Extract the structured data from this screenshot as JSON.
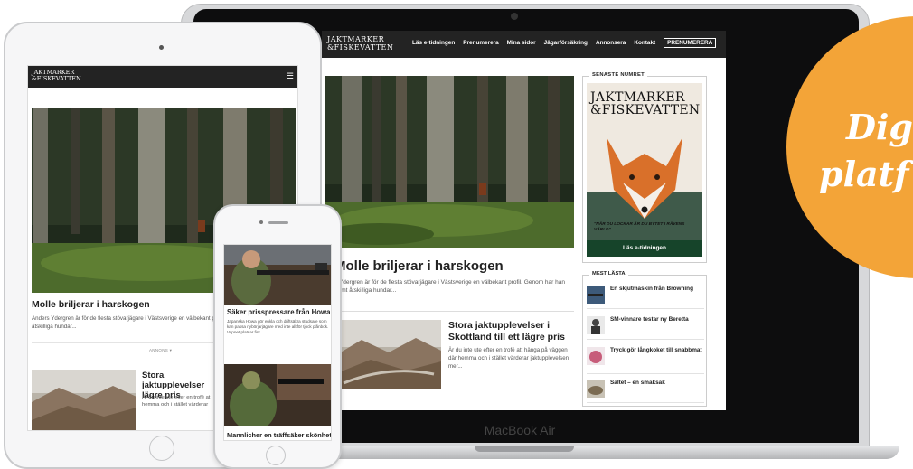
{
  "desktop": {
    "brand": "MacBook Air",
    "logo_line1": "JAKTMARKER",
    "logo_line2": "&FISKEVATTEN",
    "nav": [
      "Läs e-tidningen",
      "Prenumerera",
      "Mina sidor",
      "Jägarförsäkring",
      "Annonsera",
      "Kontakt"
    ],
    "nav_cta": "PRENUMERERA",
    "hero_title": "Molle briljerar i harskogen",
    "hero_excerpt": "s Ydergren är för de flesta stövarjägare i Västsverige en välbekant profil. Genom har han dömt åtskilliga hundar...",
    "card_title": "Stora jaktupplevelser i Skottland till ett lägre pris",
    "card_excerpt": "Är du inte ute efter en trofé att hänga på väggen där hemma och i stället värderar jaktupplevelsen mer...",
    "sidebar_latest_title": "SENASTE NUMRET",
    "cover_logo_line1": "JAKTMARKER",
    "cover_logo_line2": "&FISKEVATTEN",
    "cover_quote": "\"NÄR DU LOCKAR ÄR DU BYTET I RÄVENS VÄRLD\"",
    "read_button": "Läs e-tidningen",
    "most_read_title": "MEST LÄSTA",
    "most_read": [
      {
        "title": "En skjutmaskin från Browning"
      },
      {
        "title": "SM-vinnare testar ny Beretta"
      },
      {
        "title": "Tryck gör långkoket till snabbmat"
      },
      {
        "title": "Saltet – en smaksak"
      }
    ]
  },
  "tablet": {
    "logo_line1": "JAKTMARKER",
    "logo_line2": "&FISKEVATTEN",
    "menu_icon": "hamburger-icon",
    "hero_title": "Molle briljerar i harskogen",
    "hero_excerpt": "Anders Ydergren är för de flesta stövarjägare i Västsverige en välbekant pr åtskilliga hundar...",
    "more_label": "ANNONS ▾",
    "card_title": "Stora jaktupplevelser lägre pris",
    "card_excerpt": "Är du inte ute efter en trofé at hemma och i stället värderar"
  },
  "phone": {
    "article1_title": "Säker prisspressare från Howa",
    "article1_excerpt": "Japanska Howa gör enkla och driftsäkra studsare som kan passa nybörjarjägare med inte alltför tjock plånbok. Vapnet platsar fint...",
    "article2_title": "Mannlicher en träffsäker skönhet"
  },
  "badge": {
    "line1": "Dig",
    "line2": "platf",
    "color": "#f3a438"
  }
}
